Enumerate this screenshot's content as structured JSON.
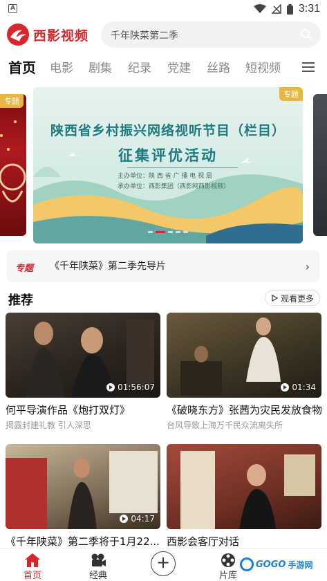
{
  "status_bar": {
    "time": "3:31",
    "left_icon": "notification-a-icon"
  },
  "header": {
    "logo_text": "西影视频",
    "search_placeholder": "千年陕菜第二季"
  },
  "nav_tabs": [
    {
      "label": "首页",
      "active": true
    },
    {
      "label": "电影"
    },
    {
      "label": "剧集"
    },
    {
      "label": "纪录"
    },
    {
      "label": "党建"
    },
    {
      "label": "丝路"
    },
    {
      "label": "短视频"
    }
  ],
  "banner": {
    "tag": "专题",
    "side_tag": "专题",
    "title_line1": "陕西省乡村振兴网络视听节目（栏目）",
    "title_line2": "征集评优活动",
    "host": "主办单位：陕 西 省 广 播 电 视 局",
    "organizer": "承办单位：西影集团（西影网西影视频）",
    "page_count": 5,
    "active_page": 1
  },
  "notice": {
    "badge": "专题",
    "text": "《千年陕菜》第二季先导片"
  },
  "recommend": {
    "title": "推荐",
    "more_label": "观看更多",
    "videos": [
      {
        "title": "何平导演作品《炮打双灯》",
        "subtitle": "揭露封建礼教 引人深思",
        "duration": "01:56:07"
      },
      {
        "title": "《破晓东方》张茜为灾民发放食物",
        "subtitle": "台风导致上海万千民众流离失所",
        "duration": "01:34"
      },
      {
        "title": "《千年陕菜》第二季将于1月22...",
        "subtitle": "",
        "duration": "04:17"
      },
      {
        "title": "西影会客厅对话",
        "subtitle": "",
        "duration": ""
      }
    ]
  },
  "bottom_nav": [
    {
      "label": "首页",
      "active": true
    },
    {
      "label": "经典"
    },
    {
      "label": ""
    },
    {
      "label": "片库"
    }
  ],
  "watermark": {
    "brand": "GOGO",
    "suffix": "手游网"
  },
  "colors": {
    "brand_red": "#d8262b",
    "banner_teal": "#1f7a80",
    "tag_gold": "#e9b642"
  }
}
